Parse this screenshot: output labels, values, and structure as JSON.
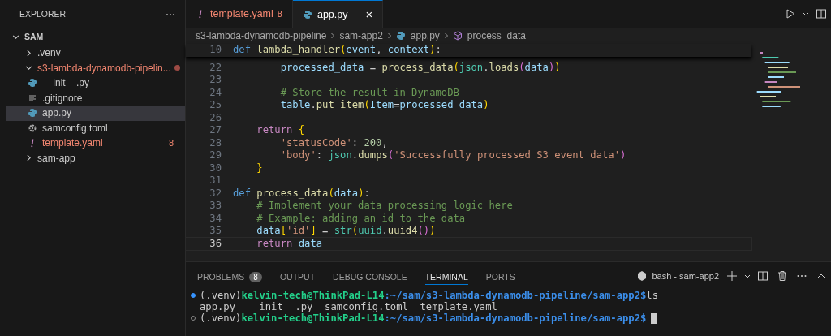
{
  "sidebar": {
    "title": "EXPLORER",
    "more": "···",
    "root": {
      "label": "SAM",
      "expanded": true,
      "children": [
        {
          "label": ".venv",
          "kind": "folder",
          "expanded": false,
          "error": false
        },
        {
          "label": "s3-lambda-dynamodb-pipelin...",
          "kind": "folder",
          "expanded": true,
          "error": true,
          "dot": true,
          "children": [
            {
              "label": "__init__.py",
              "kind": "python",
              "error": false,
              "selected": false
            },
            {
              "label": ".gitignore",
              "kind": "lines",
              "error": false,
              "selected": false
            },
            {
              "label": "app.py",
              "kind": "python",
              "error": false,
              "selected": true
            },
            {
              "label": "samconfig.toml",
              "kind": "gear",
              "error": false,
              "selected": false
            },
            {
              "label": "template.yaml",
              "kind": "yaml",
              "error": true,
              "badge": "8",
              "selected": false
            }
          ]
        },
        {
          "label": "sam-app",
          "kind": "folder",
          "expanded": false,
          "error": false
        }
      ]
    }
  },
  "tabs": [
    {
      "label": "template.yaml",
      "kind": "yaml",
      "badge": "8",
      "error": true,
      "selected": false
    },
    {
      "label": "app.py",
      "kind": "python",
      "selected": true,
      "close": "×"
    }
  ],
  "breadcrumb": [
    {
      "label": "s3-lambda-dynamodb-pipeline",
      "kind": "folder"
    },
    {
      "label": "sam-app2",
      "kind": "folder"
    },
    {
      "label": "app.py",
      "kind": "python"
    },
    {
      "label": "process_data",
      "kind": "symbol"
    }
  ],
  "editor": {
    "sticky": {
      "num": "10",
      "tokens": [
        {
          "text": "def ",
          "kind": "kw"
        },
        {
          "text": "lambda_handler",
          "kind": "fn"
        },
        {
          "text": "(",
          "kind": "br"
        },
        {
          "text": "event",
          "kind": "var"
        },
        {
          "text": ", ",
          "kind": "p"
        },
        {
          "text": "context",
          "kind": "var"
        },
        {
          "text": ")",
          "kind": "br"
        },
        {
          "text": ":",
          "kind": "p"
        }
      ]
    },
    "lines": [
      {
        "num": "22",
        "current": false,
        "tokens": [
          {
            "text": "        processed_data",
            "kind": "var"
          },
          {
            "text": " = ",
            "kind": "p"
          },
          {
            "text": "process_data",
            "kind": "fn"
          },
          {
            "text": "(",
            "kind": "br"
          },
          {
            "text": "json",
            "kind": "cls"
          },
          {
            "text": ".",
            "kind": "p"
          },
          {
            "text": "loads",
            "kind": "fn"
          },
          {
            "text": "(",
            "kind": "br2"
          },
          {
            "text": "data",
            "kind": "var"
          },
          {
            "text": ")",
            "kind": "br2"
          },
          {
            "text": ")",
            "kind": "br"
          }
        ]
      },
      {
        "num": "23",
        "current": false
      },
      {
        "num": "24",
        "current": false,
        "tokens": [
          {
            "text": "        # Store the result in DynamoDB",
            "kind": "cm"
          }
        ]
      },
      {
        "num": "25",
        "current": false,
        "tokens": [
          {
            "text": "        table",
            "kind": "var"
          },
          {
            "text": ".",
            "kind": "p"
          },
          {
            "text": "put_item",
            "kind": "fn"
          },
          {
            "text": "(",
            "kind": "br"
          },
          {
            "text": "Item",
            "kind": "var"
          },
          {
            "text": "=",
            "kind": "p"
          },
          {
            "text": "processed_data",
            "kind": "var"
          },
          {
            "text": ")",
            "kind": "br"
          }
        ]
      },
      {
        "num": "26",
        "current": false
      },
      {
        "num": "27",
        "current": false,
        "tokens": [
          {
            "text": "    return ",
            "kind": "ctl"
          },
          {
            "text": "{",
            "kind": "br"
          }
        ]
      },
      {
        "num": "28",
        "current": false,
        "tokens": [
          {
            "text": "        'statusCode'",
            "kind": "str"
          },
          {
            "text": ": ",
            "kind": "p"
          },
          {
            "text": "200",
            "kind": "num"
          },
          {
            "text": ",",
            "kind": "p"
          }
        ]
      },
      {
        "num": "29",
        "current": false,
        "tokens": [
          {
            "text": "        'body'",
            "kind": "str"
          },
          {
            "text": ": ",
            "kind": "p"
          },
          {
            "text": "json",
            "kind": "cls"
          },
          {
            "text": ".",
            "kind": "p"
          },
          {
            "text": "dumps",
            "kind": "fn"
          },
          {
            "text": "(",
            "kind": "br2"
          },
          {
            "text": "'Successfully processed S3 event data'",
            "kind": "str"
          },
          {
            "text": ")",
            "kind": "br2"
          }
        ]
      },
      {
        "num": "30",
        "current": false,
        "tokens": [
          {
            "text": "    }",
            "kind": "br"
          }
        ]
      },
      {
        "num": "31",
        "current": false
      },
      {
        "num": "32",
        "current": false,
        "tokens": [
          {
            "text": "def ",
            "kind": "kw"
          },
          {
            "text": "process_data",
            "kind": "fn"
          },
          {
            "text": "(",
            "kind": "br"
          },
          {
            "text": "data",
            "kind": "var"
          },
          {
            "text": ")",
            "kind": "br"
          },
          {
            "text": ":",
            "kind": "p"
          }
        ]
      },
      {
        "num": "33",
        "current": false,
        "tokens": [
          {
            "text": "    # Implement your data processing logic here",
            "kind": "cm"
          }
        ]
      },
      {
        "num": "34",
        "current": false,
        "tokens": [
          {
            "text": "    # Example: adding an id to the data",
            "kind": "cm"
          }
        ]
      },
      {
        "num": "35",
        "current": false,
        "tokens": [
          {
            "text": "    data",
            "kind": "var"
          },
          {
            "text": "[",
            "kind": "br"
          },
          {
            "text": "'id'",
            "kind": "str"
          },
          {
            "text": "]",
            "kind": "br"
          },
          {
            "text": " = ",
            "kind": "p"
          },
          {
            "text": "str",
            "kind": "cls"
          },
          {
            "text": "(",
            "kind": "br"
          },
          {
            "text": "uuid",
            "kind": "cls"
          },
          {
            "text": ".",
            "kind": "p"
          },
          {
            "text": "uuid4",
            "kind": "fn"
          },
          {
            "text": "(",
            "kind": "br2"
          },
          {
            "text": ")",
            "kind": "br2"
          },
          {
            "text": ")",
            "kind": "br"
          }
        ]
      },
      {
        "num": "36",
        "current": true,
        "tokens": [
          {
            "text": "    return ",
            "kind": "ctl"
          },
          {
            "text": "data",
            "kind": "var"
          }
        ]
      }
    ]
  },
  "panel": {
    "tabs": [
      {
        "label": "PROBLEMS",
        "badge": "8",
        "selected": false
      },
      {
        "label": "OUTPUT",
        "selected": false
      },
      {
        "label": "DEBUG CONSOLE",
        "selected": false
      },
      {
        "label": "TERMINAL",
        "selected": true
      },
      {
        "label": "PORTS",
        "selected": false
      }
    ],
    "terminal_name": "bash - sam-app2",
    "terminal": [
      {
        "kind": "prompt",
        "finished": true,
        "venv": "(.venv)",
        "user": "kelvin-tech@ThinkPad-L14",
        "path": ":~/sam/s3-lambda-dynamodb-pipeline/sam-app2$",
        "command": "ls",
        "cursor": false
      },
      {
        "kind": "output",
        "text": "app.py  __init__.py  samconfig.toml  template.yaml"
      },
      {
        "kind": "prompt",
        "finished": false,
        "venv": "(.venv)",
        "user": "kelvin-tech@ThinkPad-L14",
        "path": ":~/sam/s3-lambda-dynamodb-pipeline/sam-app2$",
        "cursor": true
      }
    ]
  }
}
